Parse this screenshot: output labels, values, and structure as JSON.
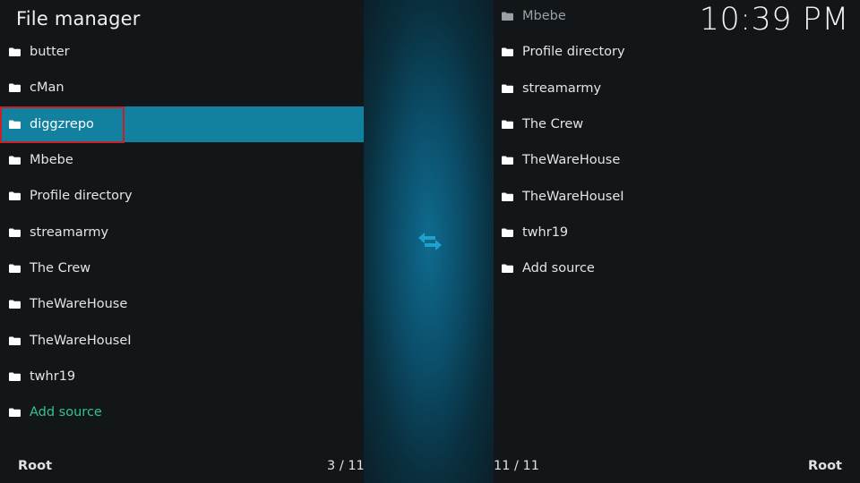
{
  "header": {
    "title": "File manager",
    "clock": "10:39 PM"
  },
  "left_pane": {
    "items": [
      {
        "label": "butter",
        "icon": "folder-icon"
      },
      {
        "label": "cMan",
        "icon": "folder-icon"
      },
      {
        "label": "diggzrepo",
        "icon": "folder-icon",
        "selected": true
      },
      {
        "label": "Mbebe",
        "icon": "folder-icon"
      },
      {
        "label": "Profile directory",
        "icon": "folder-icon"
      },
      {
        "label": "streamarmy",
        "icon": "folder-icon"
      },
      {
        "label": "The Crew",
        "icon": "folder-icon"
      },
      {
        "label": "TheWareHouse",
        "icon": "folder-icon"
      },
      {
        "label": "TheWareHouseI",
        "icon": "folder-icon"
      },
      {
        "label": "twhr19",
        "icon": "folder-icon"
      },
      {
        "label": "Add source",
        "icon": "folder-icon"
      }
    ],
    "footer_location": "Root",
    "footer_count": "3 / 11"
  },
  "right_pane": {
    "items": [
      {
        "label": "Mbebe",
        "icon": "folder-icon"
      },
      {
        "label": "Profile directory",
        "icon": "folder-icon"
      },
      {
        "label": "streamarmy",
        "icon": "folder-icon"
      },
      {
        "label": "The Crew",
        "icon": "folder-icon"
      },
      {
        "label": "TheWareHouse",
        "icon": "folder-icon"
      },
      {
        "label": "TheWareHouseI",
        "icon": "folder-icon"
      },
      {
        "label": "twhr19",
        "icon": "folder-icon"
      },
      {
        "label": "Add source",
        "icon": "folder-icon"
      }
    ],
    "footer_count": "11 / 11",
    "footer_location": "Root"
  },
  "center": {
    "icon": "swap-arrows-icon"
  },
  "colors": {
    "selection": "#12809f",
    "highlight_border": "#c8202a",
    "add_source": "#33c38e",
    "swap_icon": "#1fa0cf"
  }
}
